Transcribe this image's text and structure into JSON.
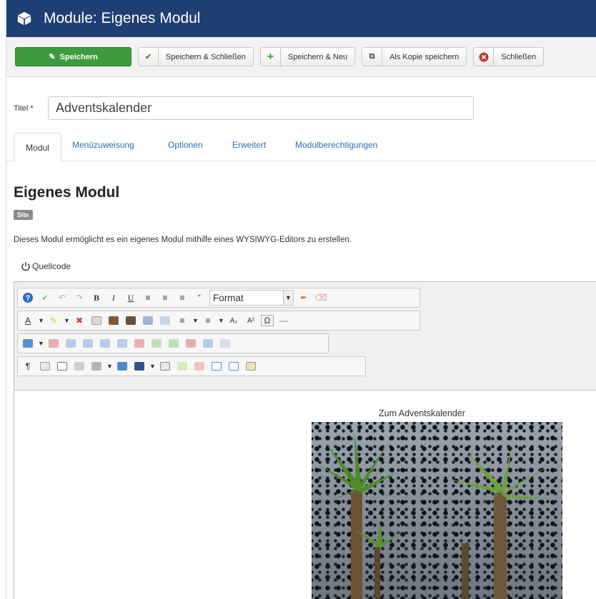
{
  "header": {
    "title": "Module: Eigenes Modul",
    "icon": "cube-icon"
  },
  "toolbar": {
    "save": "Speichern",
    "save_close": "Speichern & Schließen",
    "save_new": "Speichern & Neu",
    "save_copy": "Als Kopie speichern",
    "close": "Schließen"
  },
  "form": {
    "title_label": "Titel *",
    "title_value": "Adventskalender"
  },
  "tabs": [
    "Modul",
    "Menüzuweisung",
    "Optionen",
    "Erweitert",
    "Modulberechtigungen"
  ],
  "module": {
    "heading": "Eigenes Modul",
    "badge": "Site",
    "description": "Dieses Modul ermöglicht es ein eigenes Modul mithilfe eines WYSIWYG-Editors zu erstellen."
  },
  "editor": {
    "toggle_source": "Quellcode",
    "format_select": "Format",
    "content_caption": "Zum Adventskalender",
    "image": "palm-trees-photo"
  },
  "colors": {
    "header_bg": "#1f3f73",
    "save_green": "#3d9b3d",
    "link_blue": "#2a6fb5"
  }
}
